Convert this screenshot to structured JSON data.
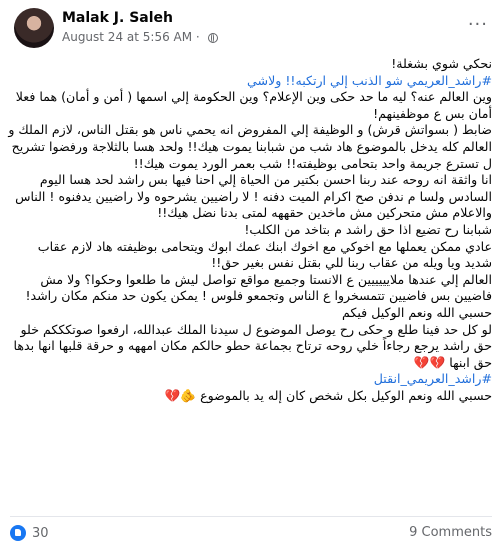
{
  "author": {
    "name": "Malak J. Saleh",
    "timestamp": "August 24 at 5:56 AM"
  },
  "post": {
    "lines": [
      "نحكي شوي بشغلة!",
      "#راشد_العريمي شو الذنب إلي ارتكبه!! ولاشي",
      "وين العالم عنه؟ ليه ما حد حكى وين الإعلام؟ وين الحكومة إلي اسمها ( أمن و أمان) هما فعلا أمان بس ع موظفينهم!",
      "ضابط ( بسواتش قرش) و الوظيفة إلي المفروض انه يحمي ناس هو بقتل الناس، لازم الملك و العالم كله يدخل بالموضوع هاد شب من شبابنا يموت هيك!! ولحد هسا بالثلاجة ورفضوا تشريح ل تسترع جريمة واحد بتحامى بوظيفته!! شب بعمر الورد يموت هيك!!",
      "انا واثقة انه روحه عند ربنا احسن بكتير من الحياة إلي احنا فيها بس راشد لحد هسا اليوم السادس ولسا م ندفن صح اكرام الميت دفنه ! لا راضيين يشرحوه ولا راضيين يدفنوه ! الناس والاعلام مش متحركين مش ماخدين حقههه لمتى بدنا نضل هيك!!",
      "شبابنا رح تضيع اذا حق راشد م بتاخد من الكلب!",
      "عادي ممكن يعملها مع اخوكي مع اخوك ابنك عمك ابوك ويتحامى بوظيفته هاد لازم عقاب شديد ويا ويله من عقاب ربنا للي بقتل نفس بغير حق!!",
      "العالم إلي عندها ملايييييين ع الانستا وجميع مواقع تواصل ليش ما طلعوا وحكوا؟ ولا مش فاضيين بس فاضيين تتمسخروا ع الناس وتجمعو فلوس ! يمكن يكون حد منكم مكان راشد!",
      "حسبي الله ونعم الوكيل فيكم",
      "لو كل حد فينا طلع و حكى رح يوصل الموضوع ل سيدنا الملك عبدالله، ارفعوا صوتكككم خلو حق راشد يرجع رجاءاً خلي روحه ترتاح بجماعة حطو حالكم مكان امههه و حرقة قلبها انها بدها حق ابنها 💔💔",
      "#راشد_العريمي_انقتل",
      "حسبي الله ونعم الوكيل بكل شخص كان إله يد بالموضوع 🫵💔"
    ]
  },
  "footer": {
    "reactions_count": "30",
    "comments_label": "9 Comments"
  },
  "colors": {
    "link": "#216fdb",
    "muted": "#65676b",
    "like": "#1877f2"
  },
  "icons": {
    "privacy": "globe-icon",
    "menu": "more-options-icon",
    "reaction": "like-icon"
  }
}
